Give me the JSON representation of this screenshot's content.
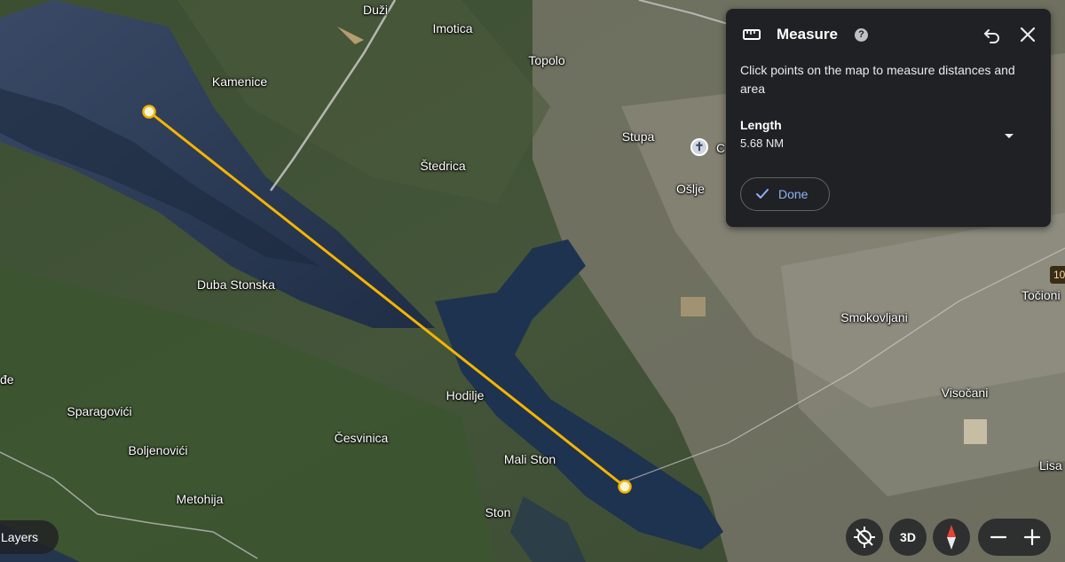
{
  "map": {
    "places": [
      {
        "name": "Duži",
        "id": "place-duzi"
      },
      {
        "name": "Imotica",
        "id": "place-imotica"
      },
      {
        "name": "Topolo",
        "id": "place-topolo"
      },
      {
        "name": "Kamenice",
        "id": "place-kamenice"
      },
      {
        "name": "Stupa",
        "id": "place-stupa"
      },
      {
        "name": "Štedrica",
        "id": "place-stedrica"
      },
      {
        "name": "Ošlje",
        "id": "place-oslje"
      },
      {
        "name": "Duba Stonska",
        "id": "place-duba-stonska"
      },
      {
        "name": "Točioni",
        "id": "place-tocioni"
      },
      {
        "name": "Smokovljani",
        "id": "place-smokovljani"
      },
      {
        "name": "đe",
        "id": "place-de"
      },
      {
        "name": "Hodilje",
        "id": "place-hodilje"
      },
      {
        "name": "Visočani",
        "id": "place-visocani"
      },
      {
        "name": "Sparagovići",
        "id": "place-sparagovici"
      },
      {
        "name": "Česvinica",
        "id": "place-cesvinica"
      },
      {
        "name": "Boljenovići",
        "id": "place-boljenovici"
      },
      {
        "name": "Mali Ston",
        "id": "place-mali-ston"
      },
      {
        "name": "Lisa",
        "id": "place-lisa"
      },
      {
        "name": "Metohija",
        "id": "place-metohija"
      },
      {
        "name": "Ston",
        "id": "place-ston"
      }
    ],
    "road_badge": "10",
    "poi_label": "C"
  },
  "measure_panel": {
    "title": "Measure",
    "help_glyph": "?",
    "instructions": "Click points on the map to measure distances and area",
    "length_label": "Length",
    "length_value": "5.68 NM",
    "done_label": "Done",
    "icons": {
      "ruler": "ruler-icon",
      "help": "help-icon",
      "undo": "undo-icon",
      "close": "close-icon",
      "dropdown": "chevron-down-icon",
      "check": "check-icon"
    }
  },
  "controls": {
    "layers_label": "Layers",
    "btn_3d_label": "3D",
    "icons": {
      "location": "location-off-icon",
      "compass": "compass-icon",
      "zoom_out": "minus-icon",
      "zoom_in": "plus-icon"
    }
  },
  "colors": {
    "measure_line": "#f4b400",
    "panel_bg": "#202124",
    "accent": "#8ab4f8"
  }
}
